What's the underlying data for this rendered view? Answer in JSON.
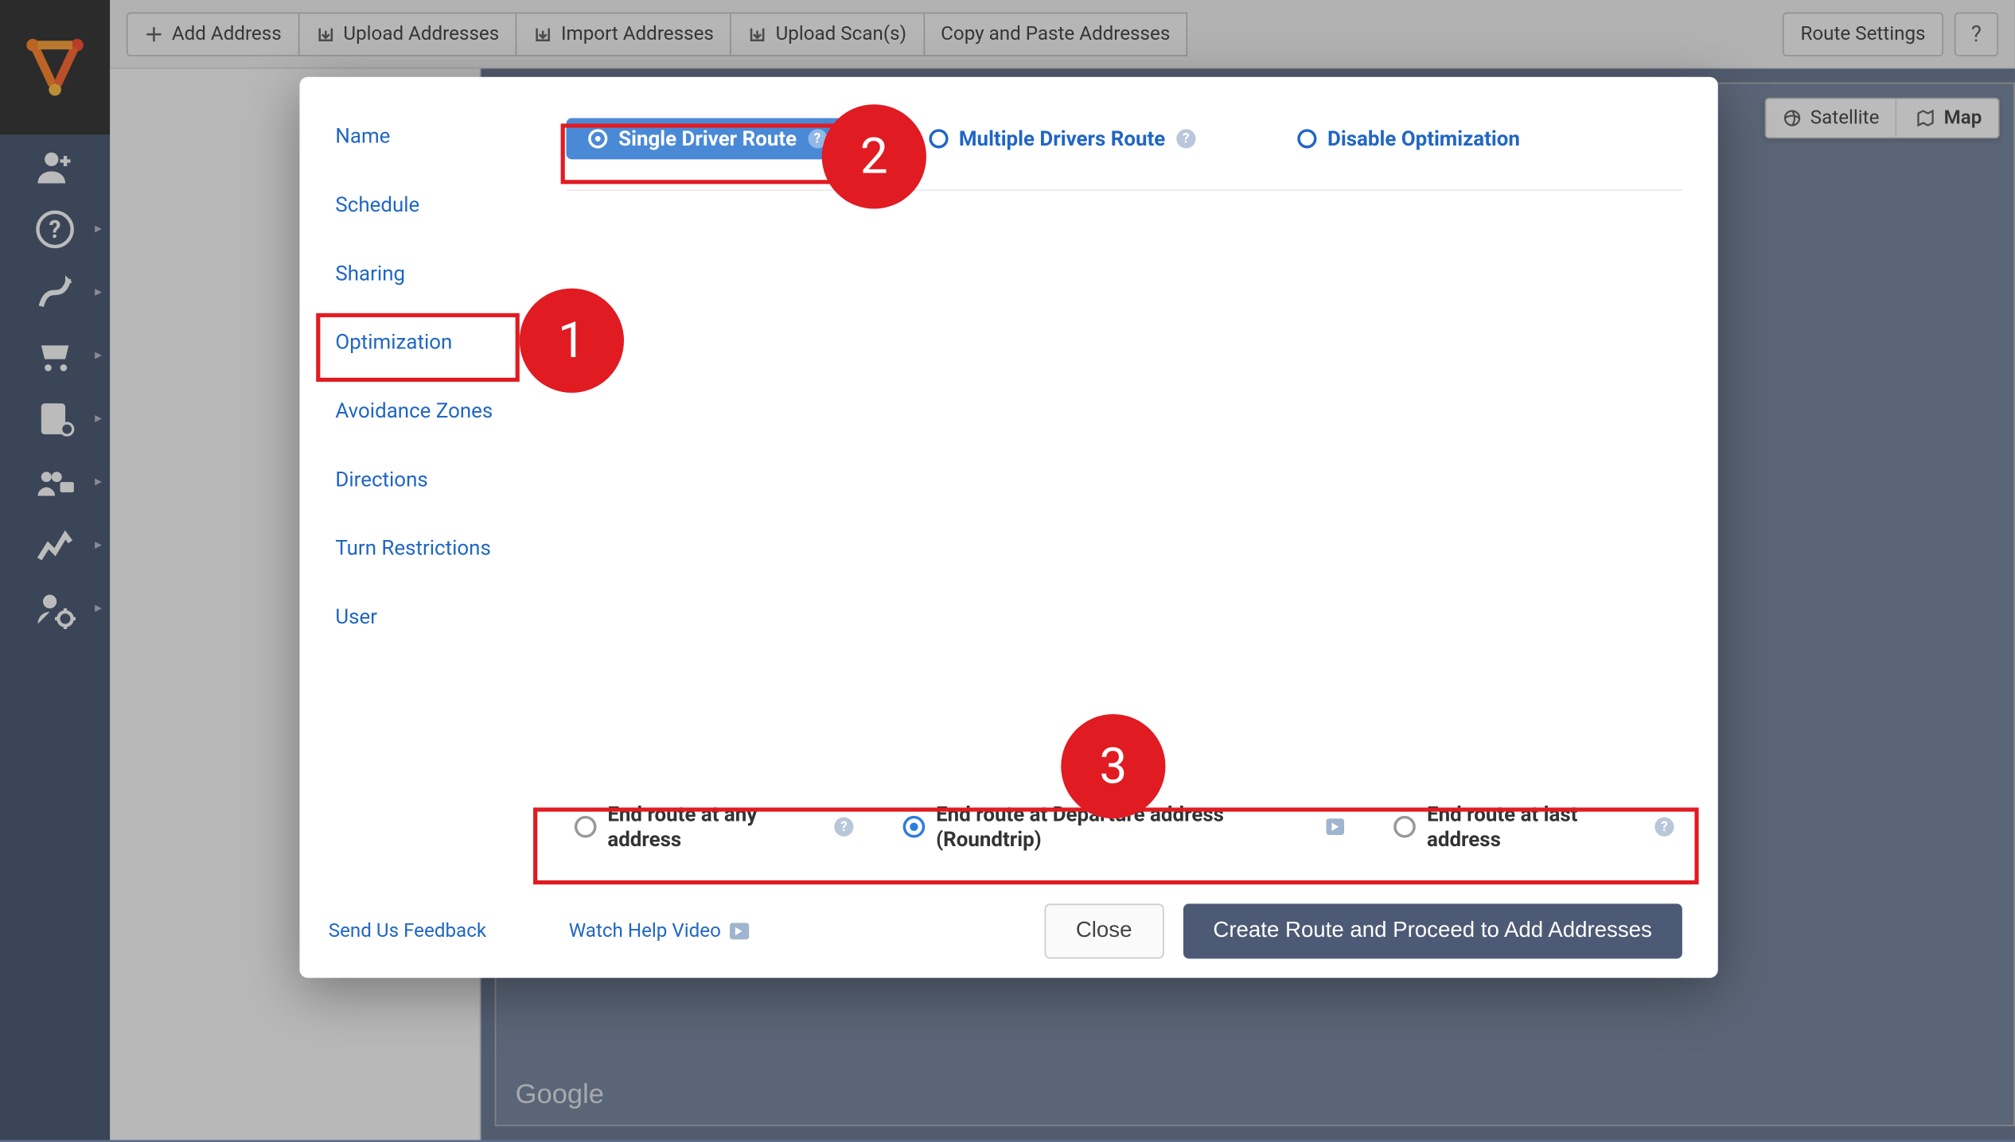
{
  "toolbar": {
    "add_address": "Add Address",
    "upload_addresses": "Upload Addresses",
    "import_addresses": "Import Addresses",
    "upload_scans": "Upload Scan(s)",
    "copy_paste": "Copy and Paste Addresses",
    "route_settings": "Route Settings"
  },
  "map": {
    "satellite": "Satellite",
    "map": "Map",
    "watermark": "Google"
  },
  "modal": {
    "sidebar": {
      "name": "Name",
      "schedule": "Schedule",
      "sharing": "Sharing",
      "optimization": "Optimization",
      "avoidance": "Avoidance Zones",
      "directions": "Directions",
      "turn": "Turn Restrictions",
      "user": "User"
    },
    "driver_options": {
      "single": "Single Driver Route",
      "multiple": "Multiple Drivers Route",
      "disable": "Disable Optimization"
    },
    "end_options": {
      "any": "End route at any address",
      "roundtrip": "End route at Departure address (Roundtrip)",
      "last": "End route at last address"
    },
    "footer": {
      "feedback": "Send Us Feedback",
      "video": "Watch Help Video",
      "close": "Close",
      "create": "Create Route and Proceed to Add Addresses"
    }
  },
  "annotations": {
    "badge1": "1",
    "badge2": "2",
    "badge3": "3"
  }
}
